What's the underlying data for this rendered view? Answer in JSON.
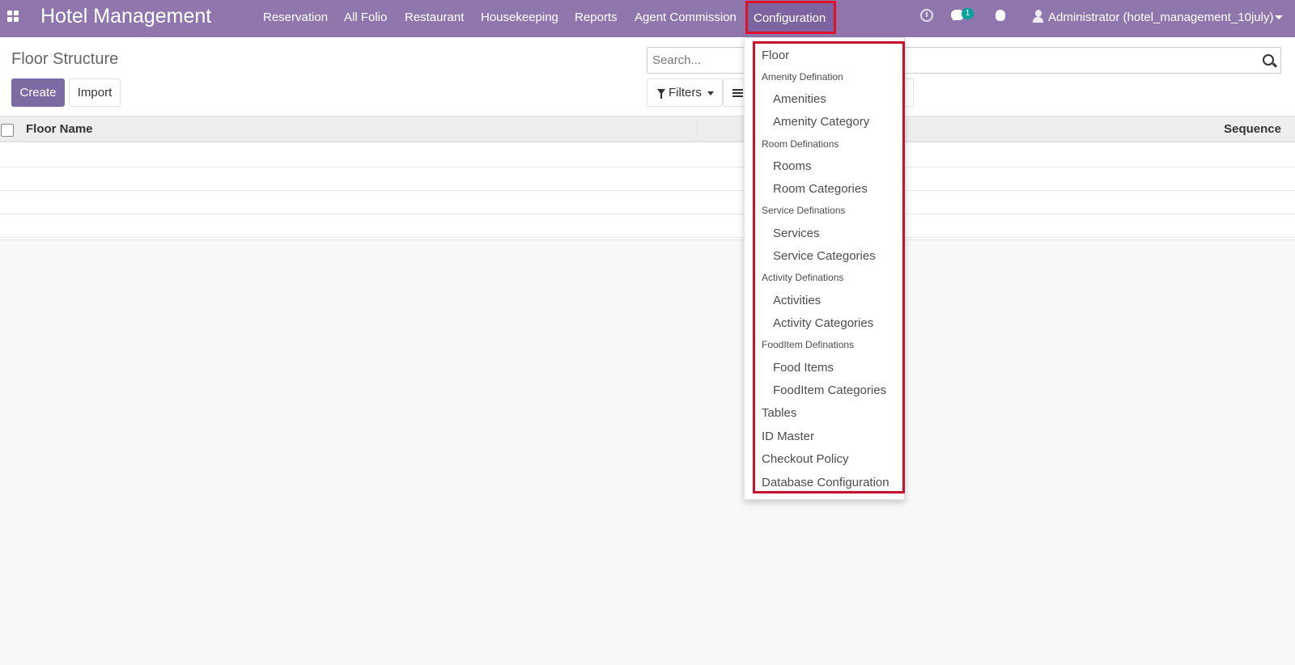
{
  "app": {
    "title": "Hotel Management"
  },
  "menu": {
    "reservation": "Reservation",
    "all_folio": "All Folio",
    "restaurant": "Restaurant",
    "housekeeping": "Housekeeping",
    "reports": "Reports",
    "agent_commission": "Agent Commission",
    "configuration": "Configuration"
  },
  "systray": {
    "messages_count": "1",
    "user": "Administrator (hotel_management_10july)",
    "icons": [
      "apps-icon",
      "clock-icon",
      "chat-icon",
      "bug-icon",
      "user-icon"
    ]
  },
  "page": {
    "title": "Floor Structure",
    "create_label": "Create",
    "import_label": "Import"
  },
  "search": {
    "placeholder": "Search...",
    "filters_label": "Filters"
  },
  "table": {
    "columns": [
      "Floor Name",
      "Sequence"
    ],
    "rows": []
  },
  "dropdown": {
    "floor": "Floor",
    "amenity_header": "Amenity Defination",
    "amenities": "Amenities",
    "amenity_category": "Amenity Category",
    "room_header": "Room Definations",
    "rooms": "Rooms",
    "room_categories": "Room Categories",
    "service_header": "Service Definations",
    "services": "Services",
    "service_categories": "Service Categories",
    "activity_header": "Activity Definations",
    "activities": "Activities",
    "activity_categories": "Activity Categories",
    "fooditem_header": "FoodItem Definations",
    "food_items": "Food Items",
    "fooditem_categories": "FoodItem Categories",
    "tables": "Tables",
    "id_master": "ID Master",
    "checkout_policy": "Checkout Policy",
    "database_configuration": "Database Configuration"
  },
  "colors": {
    "navbar": "#8f77ad",
    "primary_button": "#7c6aa3",
    "highlight_border": "#c8102e",
    "badge": "#00a09d"
  }
}
